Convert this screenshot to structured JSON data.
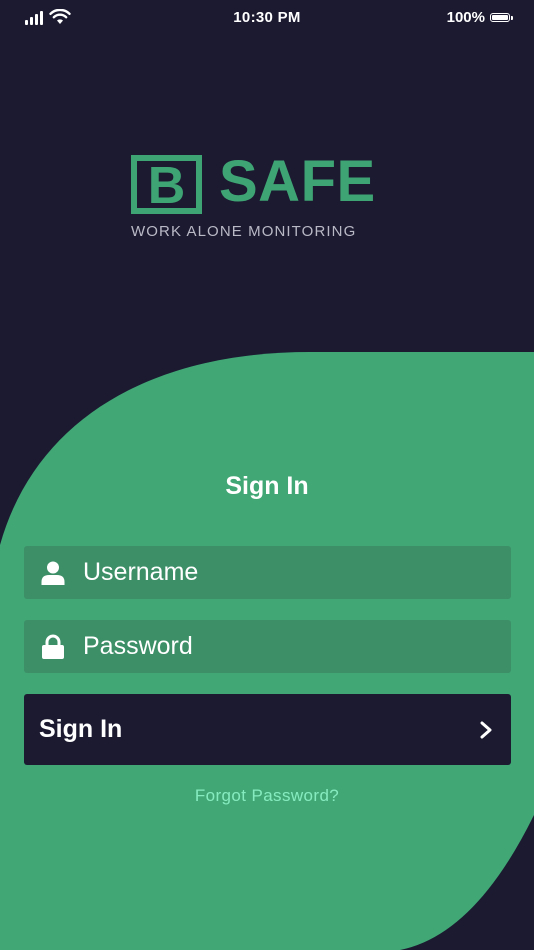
{
  "status_bar": {
    "time": "10:30 PM",
    "battery": "100%",
    "icons": [
      "cellular-signal-icon",
      "wifi-icon",
      "battery-icon"
    ]
  },
  "logo": {
    "mark_letter": "B",
    "wordmark": "SAFE",
    "tagline": "WORK ALONE MONITORING"
  },
  "signin": {
    "title": "Sign In",
    "username_placeholder": "Username",
    "password_placeholder": "Password",
    "button_label": "Sign In",
    "forgot_password": "Forgot Password?"
  },
  "colors": {
    "background": "#1b1a31",
    "brand_green": "#3fa473",
    "field_green": "#3d8f68",
    "link_green": "#86ecc0",
    "text_white": "#ffffff"
  }
}
